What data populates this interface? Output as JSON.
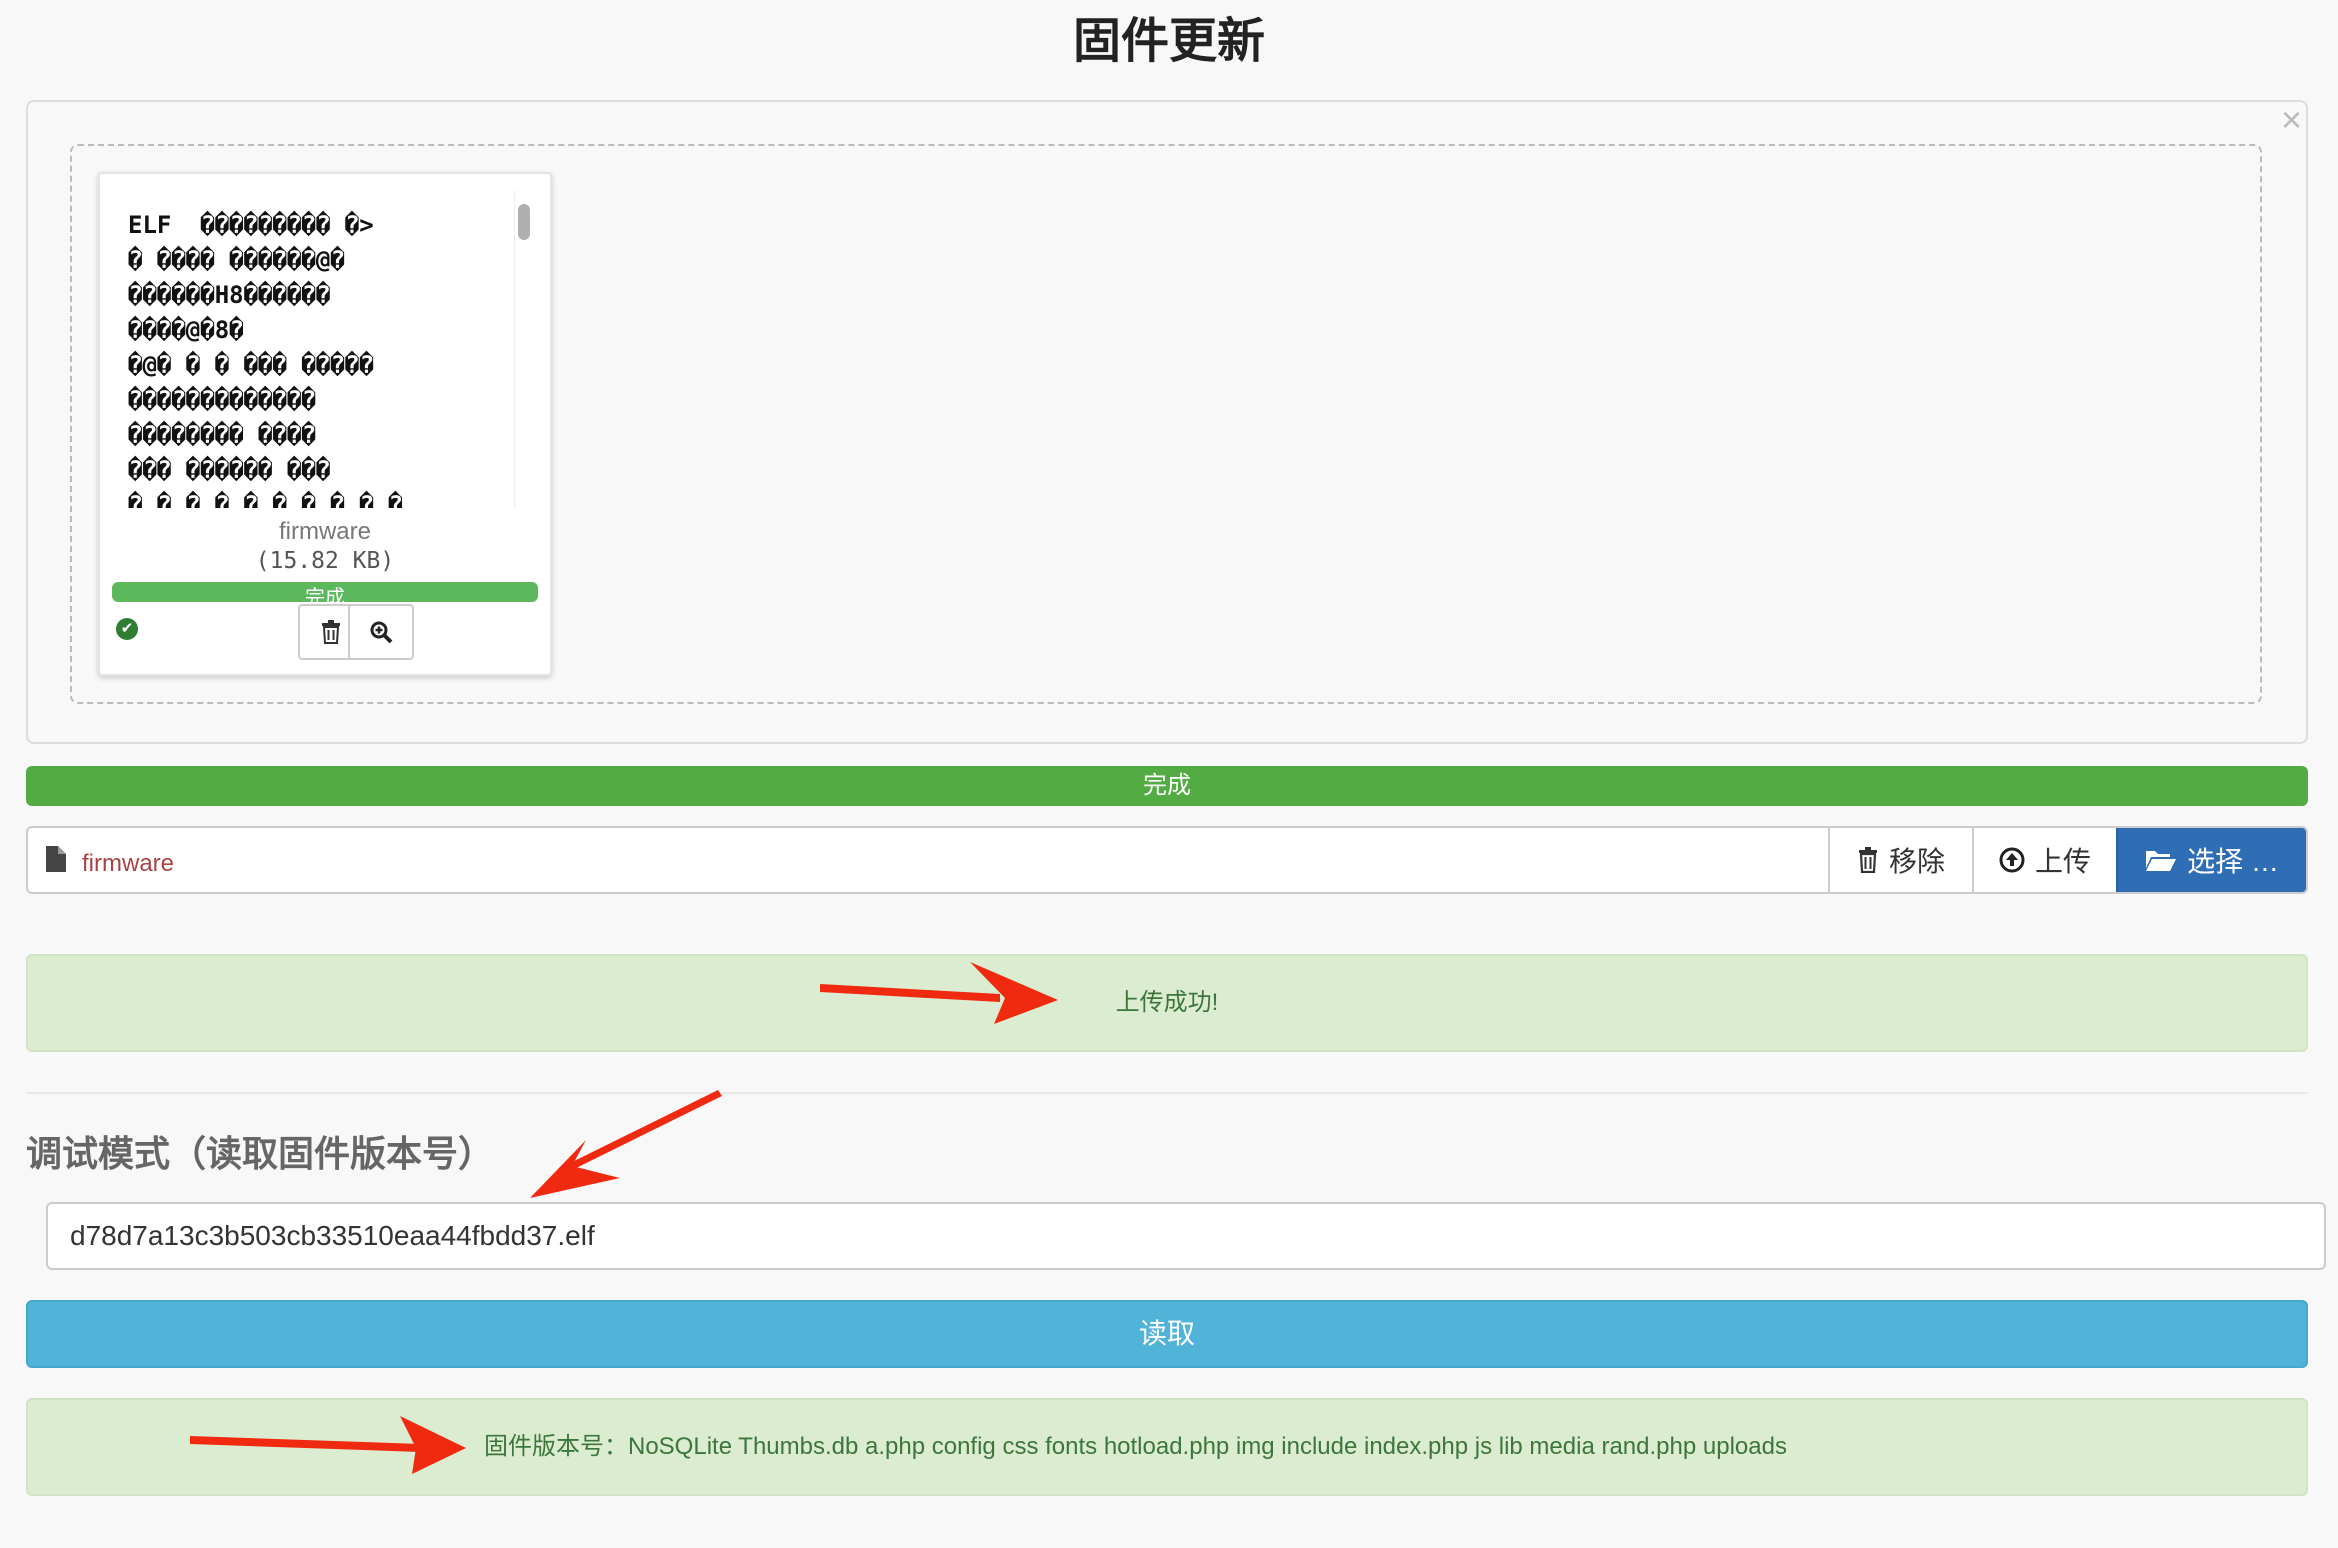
{
  "page": {
    "title": "固件更新"
  },
  "uploader": {
    "close_glyph": "×",
    "preview": {
      "content": "ELF  ��������� �>\n� ���� ������@�\n������H8������\n����@�8�\n�@� � � ��� �����\n�������������\n�������� ����\n��� ������ ���\n� � � � � � � � � �",
      "file_name": "firmware",
      "file_size": "(15.82 KB)",
      "progress_label": "完成",
      "progress_percent": 100
    },
    "icons": {
      "status": "check-circle-icon",
      "delete": "trash-icon",
      "zoom": "zoom-in-icon"
    }
  },
  "progress": {
    "label": "完成",
    "percent": 100,
    "color": "#53ab43"
  },
  "file_input": {
    "caption": "firmware",
    "remove_label": "移除",
    "upload_label": "上传",
    "browse_label": "选择 …",
    "accent_color": "#2f6db5"
  },
  "upload_alert": {
    "message": "上传成功!"
  },
  "debug": {
    "heading": "调试模式（读取固件版本号）",
    "filename_value": "d78d7a13c3b503cb33510eaa44fbdd37.elf",
    "read_button_label": "读取",
    "result_message": "固件版本号：NoSQLite Thumbs.db a.php config css fonts hotload.php img include index.php js lib media rand.php uploads"
  },
  "colors": {
    "success_bg": "#dcecd0",
    "success_text": "#3c763d",
    "info_button": "#52b3d9",
    "annotation_arrow": "#f02a10"
  }
}
